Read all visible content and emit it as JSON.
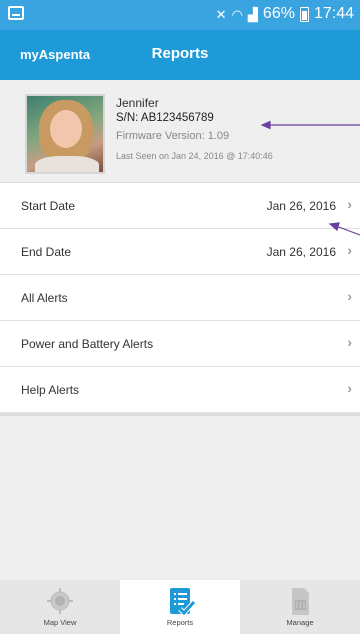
{
  "status_bar": {
    "battery": "66%",
    "time": "17:44"
  },
  "app_bar": {
    "brand": "myAspenta",
    "title": "Reports"
  },
  "profile": {
    "name": "Jennifer",
    "serial": "S/N: AB123456789",
    "firmware": "Firmware Version: 1.09",
    "last_seen": "Last Seen on Jan 24, 2016 @ 17:40:46"
  },
  "rows": [
    {
      "label": "Start Date",
      "value": "Jan 26, 2016"
    },
    {
      "label": "End Date",
      "value": "Jan 26, 2016"
    },
    {
      "label": "All Alerts"
    },
    {
      "label": "Power and Battery Alerts"
    },
    {
      "label": "Help Alerts"
    }
  ],
  "tabs": [
    {
      "label": "Map View",
      "icon": "location-crosshair-icon"
    },
    {
      "label": "Reports",
      "icon": "report-checklist-icon"
    },
    {
      "label": "Manage",
      "icon": "device-card-icon"
    }
  ],
  "colors": {
    "status_bar": "#3aa4e0",
    "app_bar": "#1f9ad9",
    "annotation_arrow": "#6b3fa0",
    "active_tab_icon": "#1f9ad9"
  }
}
